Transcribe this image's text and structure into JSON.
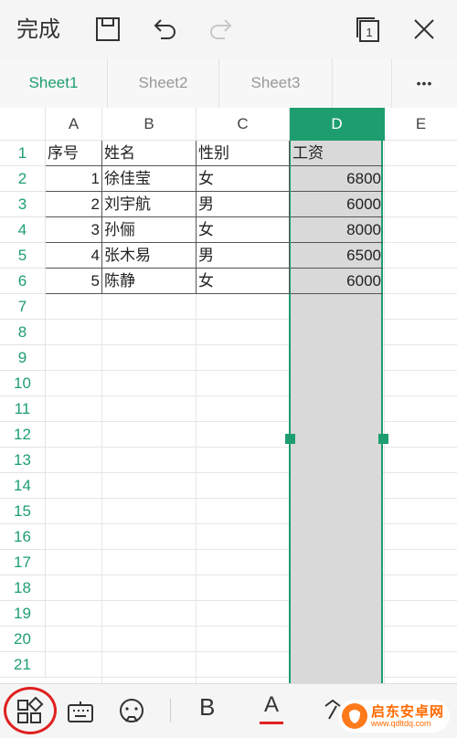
{
  "toolbar": {
    "done_label": "完成",
    "icons": [
      "save-icon",
      "undo-icon",
      "redo-icon",
      "sheet-count-icon",
      "close-icon"
    ],
    "sheet_count": "1"
  },
  "tabs": [
    {
      "label": "Sheet1",
      "active": true
    },
    {
      "label": "Sheet2",
      "active": false
    },
    {
      "label": "Sheet3",
      "active": false
    }
  ],
  "more_label": "•••",
  "columns": [
    "A",
    "B",
    "C",
    "D",
    "E"
  ],
  "selected_column": "D",
  "rows": [
    "1",
    "2",
    "3",
    "4",
    "5",
    "6",
    "7",
    "8",
    "9",
    "10",
    "11",
    "12",
    "13",
    "14",
    "15",
    "16",
    "17",
    "18",
    "19",
    "20",
    "21"
  ],
  "table": {
    "header": {
      "a": "序号",
      "b": "姓名",
      "c": "性别",
      "d": "工资"
    },
    "records": [
      {
        "a": "1",
        "b": "徐佳莹",
        "c": "女",
        "d": "6800"
      },
      {
        "a": "2",
        "b": "刘宇航",
        "c": "男",
        "d": "6000"
      },
      {
        "a": "3",
        "b": "孙俪",
        "c": "女",
        "d": "8000"
      },
      {
        "a": "4",
        "b": "张木易",
        "c": "男",
        "d": "6500"
      },
      {
        "a": "5",
        "b": "陈静",
        "c": "女",
        "d": "6000"
      }
    ]
  },
  "bottom_toolbar": {
    "icons": [
      "apps-icon",
      "keyboard-icon",
      "emoji-icon",
      "bold-icon",
      "font-color-icon",
      "clear-format-icon"
    ],
    "bold_label": "B",
    "font_color_label": "A",
    "accent_color": "#1e9e6f",
    "font_color_underline": "#e02020"
  },
  "watermark": {
    "text": "启东安卓网",
    "url": "www.qdltdq.com"
  }
}
